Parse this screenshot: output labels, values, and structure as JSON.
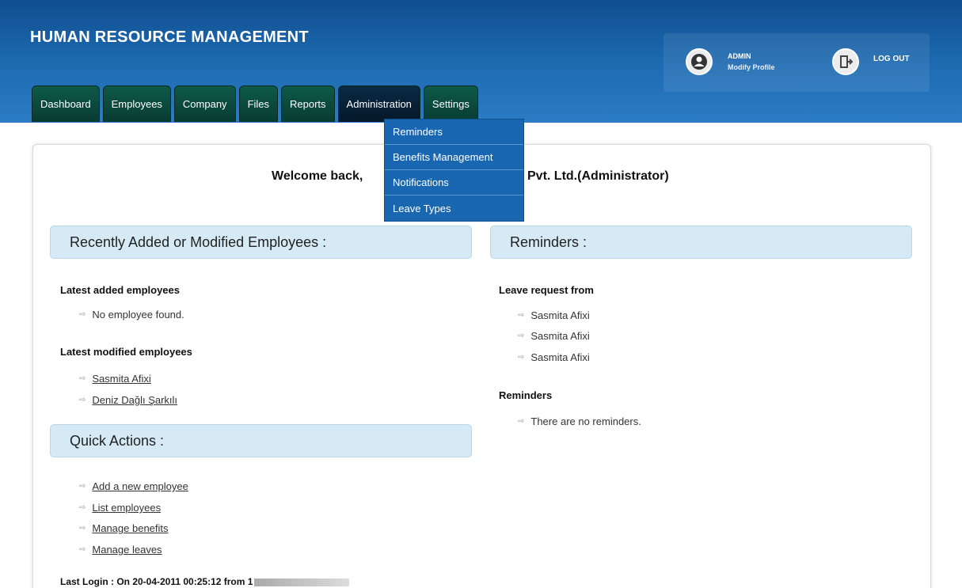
{
  "header": {
    "title": "HUMAN RESOURCE MANAGEMENT",
    "user": {
      "name": "ADMIN",
      "profile_link": "Modify Profile",
      "logout": "LOG OUT"
    }
  },
  "tabs": [
    "Dashboard",
    "Employees",
    "Company",
    "Files",
    "Reports",
    "Administration",
    "Settings"
  ],
  "active_tab": "Administration",
  "dropdown": [
    "Reminders",
    "Benefits Management",
    "Notifications",
    "Leave Types"
  ],
  "welcome": {
    "left": "Welcome back,",
    "right": "Pvt. Ltd.(Administrator)"
  },
  "recent": {
    "title": "Recently Added or Modified Employees :",
    "added_heading": "Latest added employees",
    "added_items": [
      "No employee found."
    ],
    "modified_heading": "Latest modified employees",
    "modified_items": [
      "Sasmita Afixi",
      "Deniz Dağlı Şarkılı"
    ]
  },
  "quick_actions": {
    "title": "Quick Actions :",
    "items": [
      "Add a new employee",
      "List employees",
      "Manage benefits",
      "Manage leaves"
    ]
  },
  "reminders": {
    "title": "Reminders :",
    "leave_heading": "Leave request from",
    "leave_items": [
      "Sasmita Afixi",
      "Sasmita Afixi",
      "Sasmita Afixi"
    ],
    "reminders_heading": "Reminders",
    "reminders_items": [
      "There are no reminders."
    ]
  },
  "last_login": "Last Login : On 20-04-2011 00:25:12 from 1",
  "colors": {
    "header": "#1f6cb3",
    "tab": "#0b4a3c",
    "dropdown": "#1a67b1",
    "section": "#d6eaf6"
  }
}
